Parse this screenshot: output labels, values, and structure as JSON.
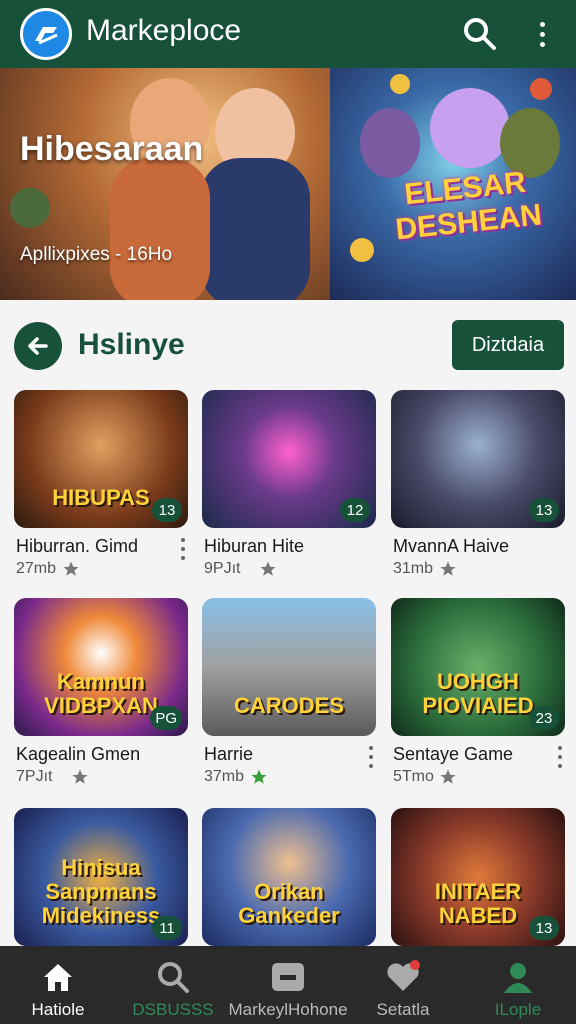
{
  "app": {
    "title": "Markeploce",
    "icons": {
      "logo": "brand-logo",
      "search": "search-icon",
      "more": "more-vertical-icon"
    }
  },
  "banner": {
    "title": "Hibesaraan",
    "subtitle": "Apllixpixes - 16Ho",
    "game_logo": "ELESAR DESHEAN"
  },
  "section": {
    "title": "Hslinye",
    "action_label": "Diztdaia",
    "back_icon": "arrow-left-icon"
  },
  "apps": [
    {
      "title": "Hiburran. Gimd",
      "size": "27mb",
      "rating": "13",
      "thumb_text": "HIBUPAS",
      "has_more": true,
      "star_color": "#777777"
    },
    {
      "title": "Hiburan Hite",
      "size": "9PJıt",
      "rating": "12",
      "thumb_text": "",
      "has_more": false,
      "star_color": "#777777"
    },
    {
      "title": "MvannA Haive",
      "size": "31mb",
      "rating": "13",
      "thumb_text": "",
      "has_more": false,
      "star_color": "#777777"
    },
    {
      "title": "Kagealin Gmen",
      "size": "7PJıt",
      "rating": "PG",
      "thumb_text": "Kamnun VIDBPXAN",
      "has_more": false,
      "star_color": "#777777"
    },
    {
      "title": "Harrie",
      "size": "37mb",
      "rating": "",
      "thumb_text": "CARODES",
      "has_more": true,
      "star_color": "#3aa03a"
    },
    {
      "title": "Sentaye Game",
      "size": "5Tmo",
      "rating": "23",
      "thumb_text": "UOHGH PIOVIAIED",
      "has_more": true,
      "star_color": "#777777"
    },
    {
      "title": "",
      "size": "",
      "rating": "11",
      "thumb_text": "Hinisua Sanpmans Midekiness",
      "has_more": false,
      "star_color": "#777777"
    },
    {
      "title": "",
      "size": "",
      "rating": "",
      "thumb_text": "Orikan Gankeder",
      "has_more": false,
      "star_color": "#777777"
    },
    {
      "title": "",
      "size": "",
      "rating": "13",
      "thumb_text": "INITAER NABED",
      "has_more": false,
      "star_color": "#777777"
    }
  ],
  "nav": [
    {
      "label": "Hatiole",
      "icon": "home-icon",
      "color": "#ffffff"
    },
    {
      "label": "DSBUSSS",
      "icon": "search-icon",
      "color": "#2e8b57"
    },
    {
      "label": "MarkeylHohone",
      "icon": "store-icon",
      "color": "#bbbbbb"
    },
    {
      "label": "Setatla",
      "icon": "heart-badge-icon",
      "color": "#bbbbbb"
    },
    {
      "label": "ILople",
      "icon": "profile-icon",
      "color": "#2e8b57"
    }
  ],
  "colors": {
    "primary": "#17513a",
    "accent": "#2e8b57",
    "nav_bg": "#2a2a2a"
  }
}
